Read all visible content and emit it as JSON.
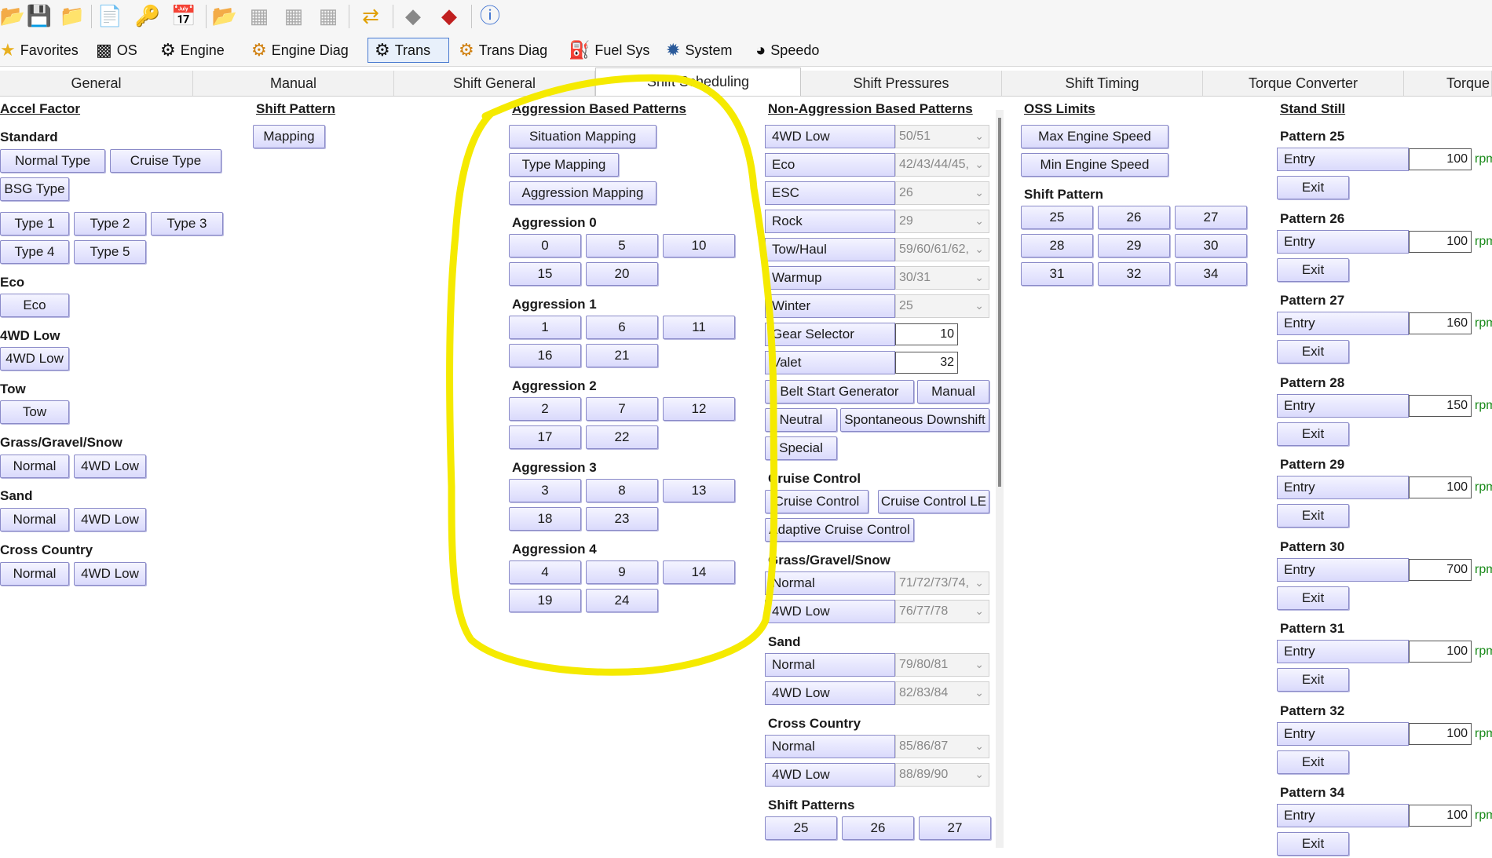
{
  "toolbar": {
    "icons": [
      "open-folder-icon",
      "save-icon",
      "folder-up-icon",
      "document-icon",
      "key-user-icon",
      "calendar-icon",
      "folder-open-icon",
      "table-icon",
      "table-icon",
      "table-icon",
      "swap-arrows-icon",
      "chip-icon",
      "chip-red-icon",
      "info-icon"
    ]
  },
  "nav": {
    "items": [
      {
        "label": "Favorites",
        "icon": "star-icon"
      },
      {
        "label": "OS",
        "icon": "chip-icon"
      },
      {
        "label": "Engine",
        "icon": "engine-icon"
      },
      {
        "label": "Engine Diag",
        "icon": "engine-diag-icon"
      },
      {
        "label": "Trans",
        "icon": "gear-icon"
      },
      {
        "label": "Trans Diag",
        "icon": "gear-diag-icon"
      },
      {
        "label": "Fuel Sys",
        "icon": "fuel-pump-icon"
      },
      {
        "label": "System",
        "icon": "system-icon"
      },
      {
        "label": "Speedo",
        "icon": "speedometer-icon"
      }
    ]
  },
  "tabs": [
    "General",
    "Manual",
    "Shift General",
    "Shift Scheduling",
    "Shift Pressures",
    "Shift Timing",
    "Torque Converter",
    "Torque"
  ],
  "col1": {
    "accel_factor": "Accel Factor",
    "standard": "Standard",
    "normal_type": "Normal Type",
    "cruise_type": "Cruise Type",
    "bsg_type": "BSG Type",
    "type1": "Type 1",
    "type2": "Type 2",
    "type3": "Type 3",
    "type4": "Type 4",
    "type5": "Type 5",
    "eco_h": "Eco",
    "eco": "Eco",
    "fwd_h": "4WD Low",
    "fwd": "4WD Low",
    "tow_h": "Tow",
    "tow": "Tow",
    "ggs_h": "Grass/Gravel/Snow",
    "ggs_normal": "Normal",
    "ggs_4wd": "4WD Low",
    "sand_h": "Sand",
    "sand_normal": "Normal",
    "sand_4wd": "4WD Low",
    "cc_h": "Cross Country",
    "cc_normal": "Normal",
    "cc_4wd": "4WD Low"
  },
  "col2": {
    "shift_pattern": "Shift Pattern",
    "mapping": "Mapping"
  },
  "aggression": {
    "header": "Aggression Based Patterns",
    "situation_mapping": "Situation Mapping",
    "type_mapping": "Type Mapping",
    "aggression_mapping": "Aggression Mapping",
    "groups": [
      {
        "title": "Aggression 0",
        "buttons": [
          "0",
          "5",
          "10",
          "15",
          "20"
        ]
      },
      {
        "title": "Aggression 1",
        "buttons": [
          "1",
          "6",
          "11",
          "16",
          "21"
        ]
      },
      {
        "title": "Aggression 2",
        "buttons": [
          "2",
          "7",
          "12",
          "17",
          "22"
        ]
      },
      {
        "title": "Aggression 3",
        "buttons": [
          "3",
          "8",
          "13",
          "18",
          "23"
        ]
      },
      {
        "title": "Aggression 4",
        "buttons": [
          "4",
          "9",
          "14",
          "19",
          "24"
        ]
      }
    ]
  },
  "non_aggression": {
    "header": "Non-Aggression Based Patterns",
    "rows": [
      {
        "label": "4WD Low",
        "value": "50/51"
      },
      {
        "label": "Eco",
        "value": "42/43/44/45,"
      },
      {
        "label": "ESC",
        "value": "26"
      },
      {
        "label": "Rock",
        "value": "29"
      },
      {
        "label": "Tow/Haul",
        "value": "59/60/61/62,"
      },
      {
        "label": "Warmup",
        "value": "30/31"
      },
      {
        "label": "Winter",
        "value": "25"
      }
    ],
    "gear_selector": {
      "label": "Gear Selector",
      "value": "10"
    },
    "valet": {
      "label": "Valet",
      "value": "32"
    },
    "belt_start_generator": "Belt Start Generator",
    "manual": "Manual",
    "neutral": "Neutral",
    "spontaneous_downshift": "Spontaneous Downshift",
    "special": "Special",
    "cruise_control_h": "Cruise Control",
    "cruise_control": "Cruise Control",
    "cruise_control_le": "Cruise Control LE",
    "adaptive_cruise_control": "Adaptive Cruise Control",
    "ggs_h": "Grass/Gravel/Snow",
    "ggs_rows": [
      {
        "label": "Normal",
        "value": "71/72/73/74,"
      },
      {
        "label": "4WD Low",
        "value": "76/77/78"
      }
    ],
    "sand_h": "Sand",
    "sand_rows": [
      {
        "label": "Normal",
        "value": "79/80/81"
      },
      {
        "label": "4WD Low",
        "value": "82/83/84"
      }
    ],
    "cc_h": "Cross Country",
    "cc_rows": [
      {
        "label": "Normal",
        "value": "85/86/87"
      },
      {
        "label": "4WD Low",
        "value": "88/89/90"
      }
    ],
    "shift_patterns_h": "Shift Patterns",
    "shift_patterns": [
      "25",
      "26",
      "27"
    ]
  },
  "oss": {
    "header": "OSS Limits",
    "max_engine_speed": "Max Engine Speed",
    "min_engine_speed": "Min Engine Speed",
    "shift_pattern_h": "Shift Pattern",
    "patterns": [
      "25",
      "26",
      "27",
      "28",
      "29",
      "30",
      "31",
      "32",
      "34"
    ]
  },
  "stand_still": {
    "header": "Stand Still",
    "entry_label": "Entry",
    "exit_label": "Exit",
    "unit": "rpm",
    "patterns": [
      {
        "title": "Pattern 25",
        "entry": "100"
      },
      {
        "title": "Pattern 26",
        "entry": "100"
      },
      {
        "title": "Pattern 27",
        "entry": "160"
      },
      {
        "title": "Pattern 28",
        "entry": "150"
      },
      {
        "title": "Pattern 29",
        "entry": "100"
      },
      {
        "title": "Pattern 30",
        "entry": "700"
      },
      {
        "title": "Pattern 31",
        "entry": "100"
      },
      {
        "title": "Pattern 32",
        "entry": "100"
      },
      {
        "title": "Pattern 34",
        "entry": "100"
      }
    ]
  },
  "colors": {
    "highlight": "#f5ea00",
    "button_border": "#8a8ac8",
    "rpm": "#1a8a1a"
  }
}
